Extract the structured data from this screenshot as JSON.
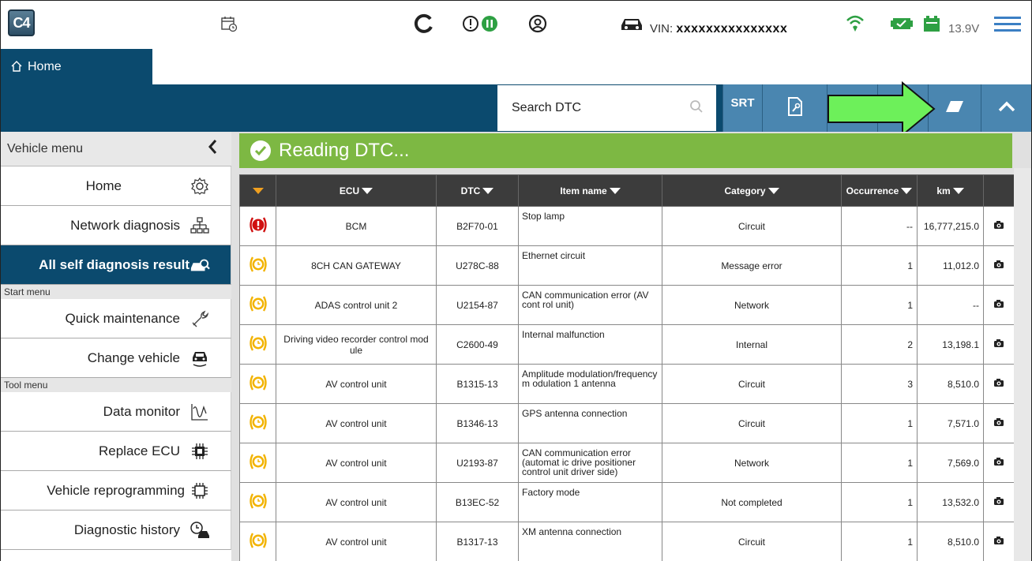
{
  "topbar": {
    "logo": "C4",
    "vin_label": "VIN:",
    "vin_value": "xxxxxxxxxxxxxxx",
    "voltage": "13.9V",
    "icons": [
      "calendar-clock-icon",
      "refresh-icon",
      "alert-status-icon",
      "user-icon",
      "car-icon",
      "wireless-icon",
      "connector-icon",
      "battery-icon",
      "hamburger-menu-icon"
    ]
  },
  "tabs": {
    "home_label": "Home"
  },
  "toolbar": {
    "search_placeholder": "Search DTC",
    "srt_label": "SRT"
  },
  "sidebar": {
    "vehicle_menu_label": "Vehicle menu",
    "vehicle_items": [
      {
        "label": "Home",
        "icon": "gear-icon"
      },
      {
        "label": "Network diagnosis",
        "icon": "network-icon"
      },
      {
        "label": "All self diagnosis result",
        "icon": "car-search-icon"
      }
    ],
    "start_menu_label": "Start menu",
    "start_items": [
      {
        "label": "Quick maintenance",
        "icon": "wrench-icon"
      },
      {
        "label": "Change vehicle",
        "icon": "car-change-icon"
      }
    ],
    "tool_menu_label": "Tool menu",
    "tool_items": [
      {
        "label": "Data monitor",
        "icon": "waveform-icon"
      },
      {
        "label": "Replace ECU",
        "icon": "chip-icon"
      },
      {
        "label": "Vehicle reprogramming",
        "icon": "chip-outline-icon"
      },
      {
        "label": "Diagnostic history",
        "icon": "history-car-icon"
      }
    ]
  },
  "main": {
    "banner_title": "Reading DTC...",
    "columns": {
      "ecu": "ECU",
      "dtc": "DTC",
      "item_name": "Item name",
      "category": "Category",
      "occurrence": "Occurrence",
      "km": "km"
    },
    "rows": [
      {
        "status": "error",
        "ecu": "BCM",
        "dtc": "B2F70-01",
        "item": "Stop lamp",
        "category": "Circuit",
        "occurrence": "--",
        "km": "16,777,215.0"
      },
      {
        "status": "pending",
        "ecu": "8CH CAN GATEWAY",
        "dtc": "U278C-88",
        "item": "Ethernet circuit",
        "category": "Message error",
        "occurrence": "1",
        "km": "11,012.0"
      },
      {
        "status": "pending",
        "ecu": "ADAS control unit 2",
        "dtc": "U2154-87",
        "item": "CAN communication error (AV cont rol unit)",
        "category": "Network",
        "occurrence": "1",
        "km": "--"
      },
      {
        "status": "pending",
        "ecu": "Driving video recorder control mod ule",
        "dtc": "C2600-49",
        "item": "Internal malfunction",
        "category": "Internal",
        "occurrence": "2",
        "km": "13,198.1"
      },
      {
        "status": "pending",
        "ecu": "AV control unit",
        "dtc": "B1315-13",
        "item": "Amplitude modulation/frequency m odulation 1 antenna",
        "category": "Circuit",
        "occurrence": "3",
        "km": "8,510.0"
      },
      {
        "status": "pending",
        "ecu": "AV control unit",
        "dtc": "B1346-13",
        "item": "GPS antenna connection",
        "category": "Circuit",
        "occurrence": "1",
        "km": "7,571.0"
      },
      {
        "status": "pending",
        "ecu": "AV control unit",
        "dtc": "U2193-87",
        "item": "CAN communication error (automat ic drive positioner control unit driver side)",
        "category": "Network",
        "occurrence": "1",
        "km": "7,569.0"
      },
      {
        "status": "pending",
        "ecu": "AV control unit",
        "dtc": "B13EC-52",
        "item": "Factory mode",
        "category": "Not completed",
        "occurrence": "1",
        "km": "13,532.0"
      },
      {
        "status": "pending",
        "ecu": "AV control unit",
        "dtc": "B1317-13",
        "item": "XM antenna connection",
        "category": "Circuit",
        "occurrence": "1",
        "km": "8,510.0"
      }
    ]
  },
  "colors": {
    "navy": "#0b4a6e",
    "toolbar_button": "#4a86b0",
    "banner_green": "#7db843",
    "error_red": "#d01010",
    "pending_yellow": "#f2b300",
    "highlight_arrow": "#6df05a"
  }
}
